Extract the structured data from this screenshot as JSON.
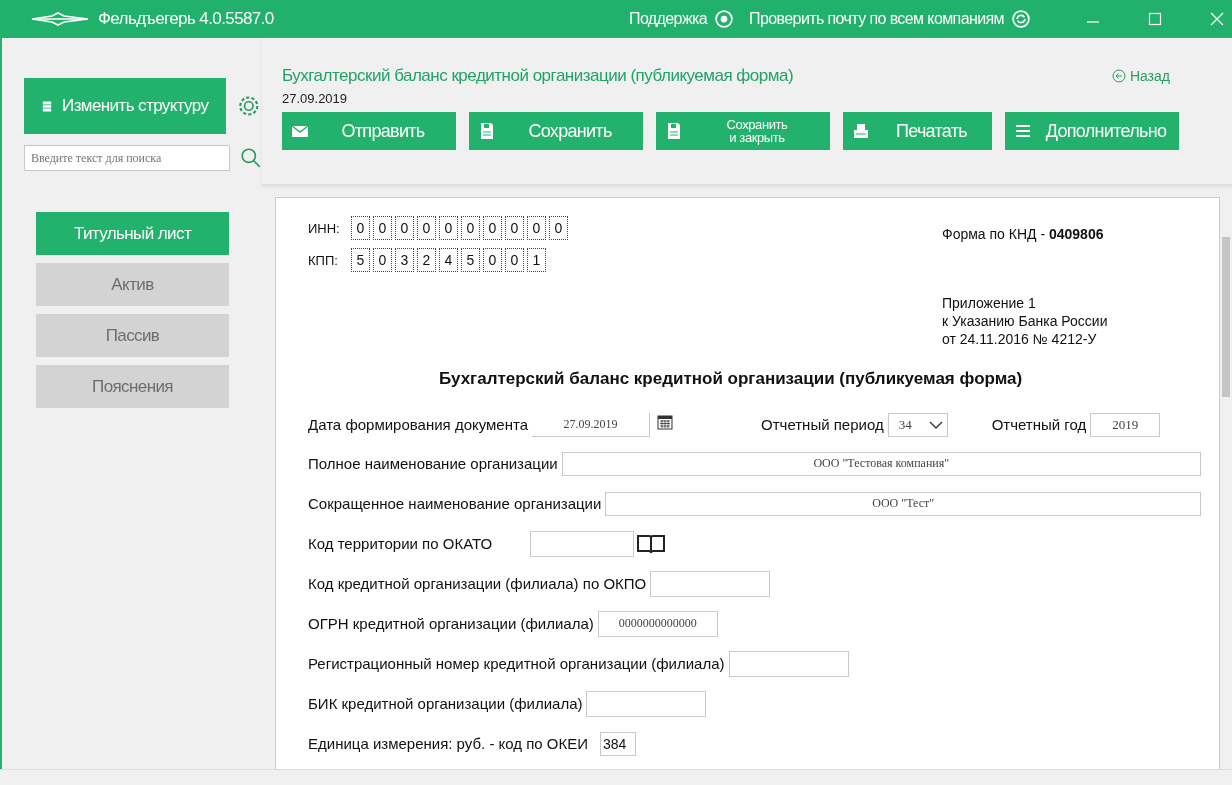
{
  "title_bar": {
    "app_title": "Фельдъегерь 4.0.5587.0",
    "support": "Поддержка",
    "check_mail": "Проверить почту по всем компаниям"
  },
  "sidebar": {
    "change_structure": "Изменить структуру",
    "search": {
      "placeholder": "Введите текст для поиска"
    },
    "sections": [
      {
        "label": "Титульный лист",
        "selected": true
      },
      {
        "label": "Актив",
        "selected": false
      },
      {
        "label": "Пассив",
        "selected": false
      },
      {
        "label": "Пояснения",
        "selected": false
      }
    ]
  },
  "header": {
    "title": "Бухгалтерский баланс кредитной организации (публикуемая форма)",
    "date": "27.09.2019",
    "back": "Назад",
    "buttons": [
      {
        "label": "Отправить",
        "kind": "send",
        "small": false
      },
      {
        "label": "Сохранить",
        "kind": "save",
        "small": false
      },
      {
        "label": "Сохранить\nи закрыть",
        "kind": "save",
        "small": true
      },
      {
        "label": "Печатать",
        "kind": "print",
        "small": false
      },
      {
        "label": "Дополнительно",
        "kind": "menu",
        "small": false
      }
    ]
  },
  "form": {
    "inn": {
      "label": "ИНН:",
      "digits": [
        "0",
        "0",
        "0",
        "0",
        "0",
        "0",
        "0",
        "0",
        "0",
        "0"
      ]
    },
    "kpp": {
      "label": "КПП:",
      "digits": [
        "5",
        "0",
        "3",
        "2",
        "4",
        "5",
        "0",
        "0",
        "1"
      ]
    },
    "knd": "Форма по КНД - **0409806**",
    "appendix": [
      "Приложение 1",
      "к Указанию Банка России",
      "от 24.11.2016 № 4212-У"
    ],
    "title": "Бухгалтерский баланс кредитной организации (публикуемая форма)",
    "date_label": "Дата формирования документа",
    "date_value": "27.09.2019",
    "period_label": "Отчетный период",
    "period_value": "34",
    "year_label": "Отчетный год",
    "year_value": "2019",
    "fields": [
      {
        "label": "Полное наименование организации",
        "value": "ООО \"Тестовая компания\"",
        "kind": "wide"
      },
      {
        "label": "Сокращенное наименование организации",
        "value": "ООО \"Тест\"",
        "kind": "wide"
      },
      {
        "label": "Код территории по ОКАТО",
        "kind": "lookup"
      },
      {
        "label": "Код кредитной организации (филиала) по ОКПО",
        "kind": "short"
      },
      {
        "label": "ОГРН кредитной организации (филиала)",
        "value": "0000000000000",
        "kind": "short"
      },
      {
        "label": "Регистрационный номер кредитной организации (филиала)",
        "kind": "short"
      },
      {
        "label": "БИК кредитной организации (филиала)",
        "kind": "short"
      },
      {
        "label": "Единица измерения: руб. - код по ОКЕИ",
        "value": "384",
        "kind": "code"
      }
    ]
  }
}
